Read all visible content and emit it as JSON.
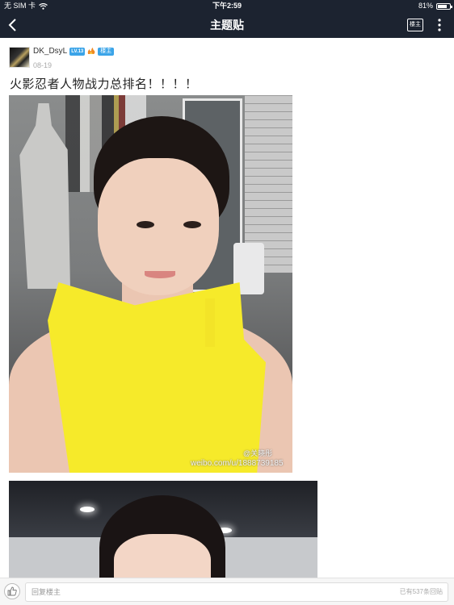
{
  "status_bar": {
    "carrier": "无 SIM 卡",
    "time": "下午2:59",
    "battery_text": "81%",
    "battery_level": 0.81
  },
  "nav": {
    "title": "主题贴",
    "louzhu_label": "楼主"
  },
  "post": {
    "username": "DK_DsyL",
    "level": "LV.13",
    "owner_badge": "楼主",
    "date": "08-19",
    "title": "火影忍者人物战力总排名！！！！"
  },
  "photo1": {
    "watermark_url": "weibo.com/u/1888739185",
    "watermark_handle": "@关晓彤"
  },
  "bottom_bar": {
    "reply_placeholder": "回复楼主",
    "reply_count": "已有537条回贴"
  },
  "colors": {
    "nav_background": "#1c2330",
    "badge_blue": "#3ba4e8"
  }
}
